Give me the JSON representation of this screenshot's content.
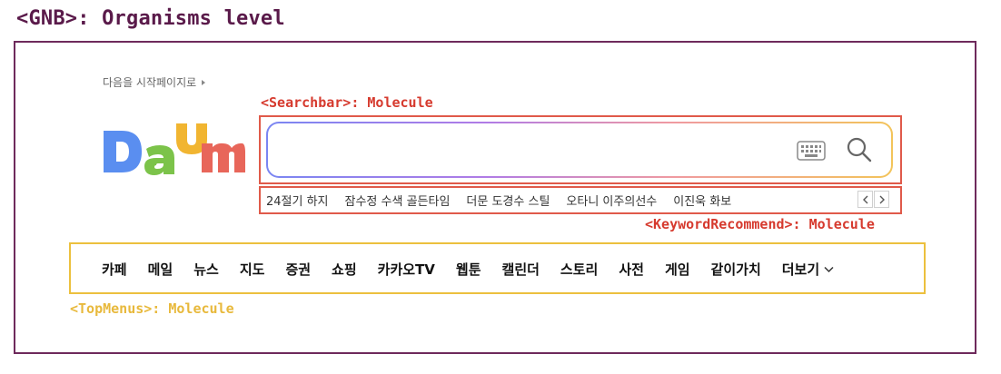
{
  "heading": "<GNB>: Organisms level",
  "start_page_link": "다음을 시작페이지로",
  "annotations": {
    "searchbar": "<Searchbar>: Molecule",
    "keyword_recommend": "<KeywordRecommend>: Molecule",
    "top_menus": "<TopMenus>: Molecule"
  },
  "logo": {
    "letters": [
      "D",
      "a",
      "U",
      "m"
    ],
    "colors": {
      "D": "#5a8ef0",
      "a": "#7cc34a",
      "U": "#f1b531",
      "m": "#e8665a"
    }
  },
  "search": {
    "value": "",
    "placeholder": "",
    "keyboard_icon": "keyboard-icon",
    "search_icon": "search-icon",
    "gradient_colors": [
      "#7a86f2",
      "#b07be6",
      "#f09aa0",
      "#f3c45a"
    ]
  },
  "keywords": [
    "24절기 하지",
    "잠수정 수색 골든타임",
    "더문 도경수 스틸",
    "오타니 이주의선수",
    "이진욱 화보"
  ],
  "top_menus": [
    "카페",
    "메일",
    "뉴스",
    "지도",
    "증권",
    "쇼핑",
    "카카오TV",
    "웹툰",
    "캘린더",
    "스토리",
    "사전",
    "게임",
    "같이가치"
  ],
  "more_label": "더보기",
  "colors": {
    "frame": "#6e2a5c",
    "molecule_red": "#d63a2e",
    "molecule_yellow": "#e8b93c"
  }
}
